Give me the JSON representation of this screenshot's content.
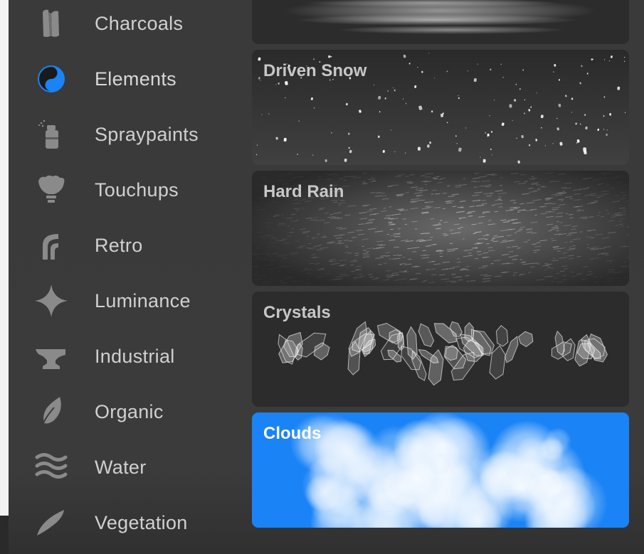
{
  "sidebar": {
    "items": [
      {
        "label": "Charcoals",
        "icon": "charcoal-icon"
      },
      {
        "label": "Elements",
        "icon": "yin-yang-icon",
        "selected": true
      },
      {
        "label": "Spraypaints",
        "icon": "spray-can-icon"
      },
      {
        "label": "Touchups",
        "icon": "touchup-brush-icon"
      },
      {
        "label": "Retro",
        "icon": "retro-arch-icon"
      },
      {
        "label": "Luminance",
        "icon": "sparkle-icon"
      },
      {
        "label": "Industrial",
        "icon": "anvil-icon"
      },
      {
        "label": "Organic",
        "icon": "leaf-icon"
      },
      {
        "label": "Water",
        "icon": "waves-icon"
      },
      {
        "label": "Vegetation",
        "icon": "blade-icon"
      }
    ]
  },
  "brushes": {
    "items": [
      {
        "name": "",
        "preview": "streaks-preview"
      },
      {
        "name": "Driven Snow",
        "preview": "snow-preview"
      },
      {
        "name": "Hard Rain",
        "preview": "rain-preview"
      },
      {
        "name": "Crystals",
        "preview": "crystals-preview"
      },
      {
        "name": "Clouds",
        "preview": "clouds-preview",
        "selected": true
      }
    ]
  },
  "colors": {
    "accent": "#1a83f5",
    "panel": "#3a3a3a",
    "card": "#2c2c2c",
    "label": "#d0d0d0",
    "icon": "#8a8a8a"
  }
}
